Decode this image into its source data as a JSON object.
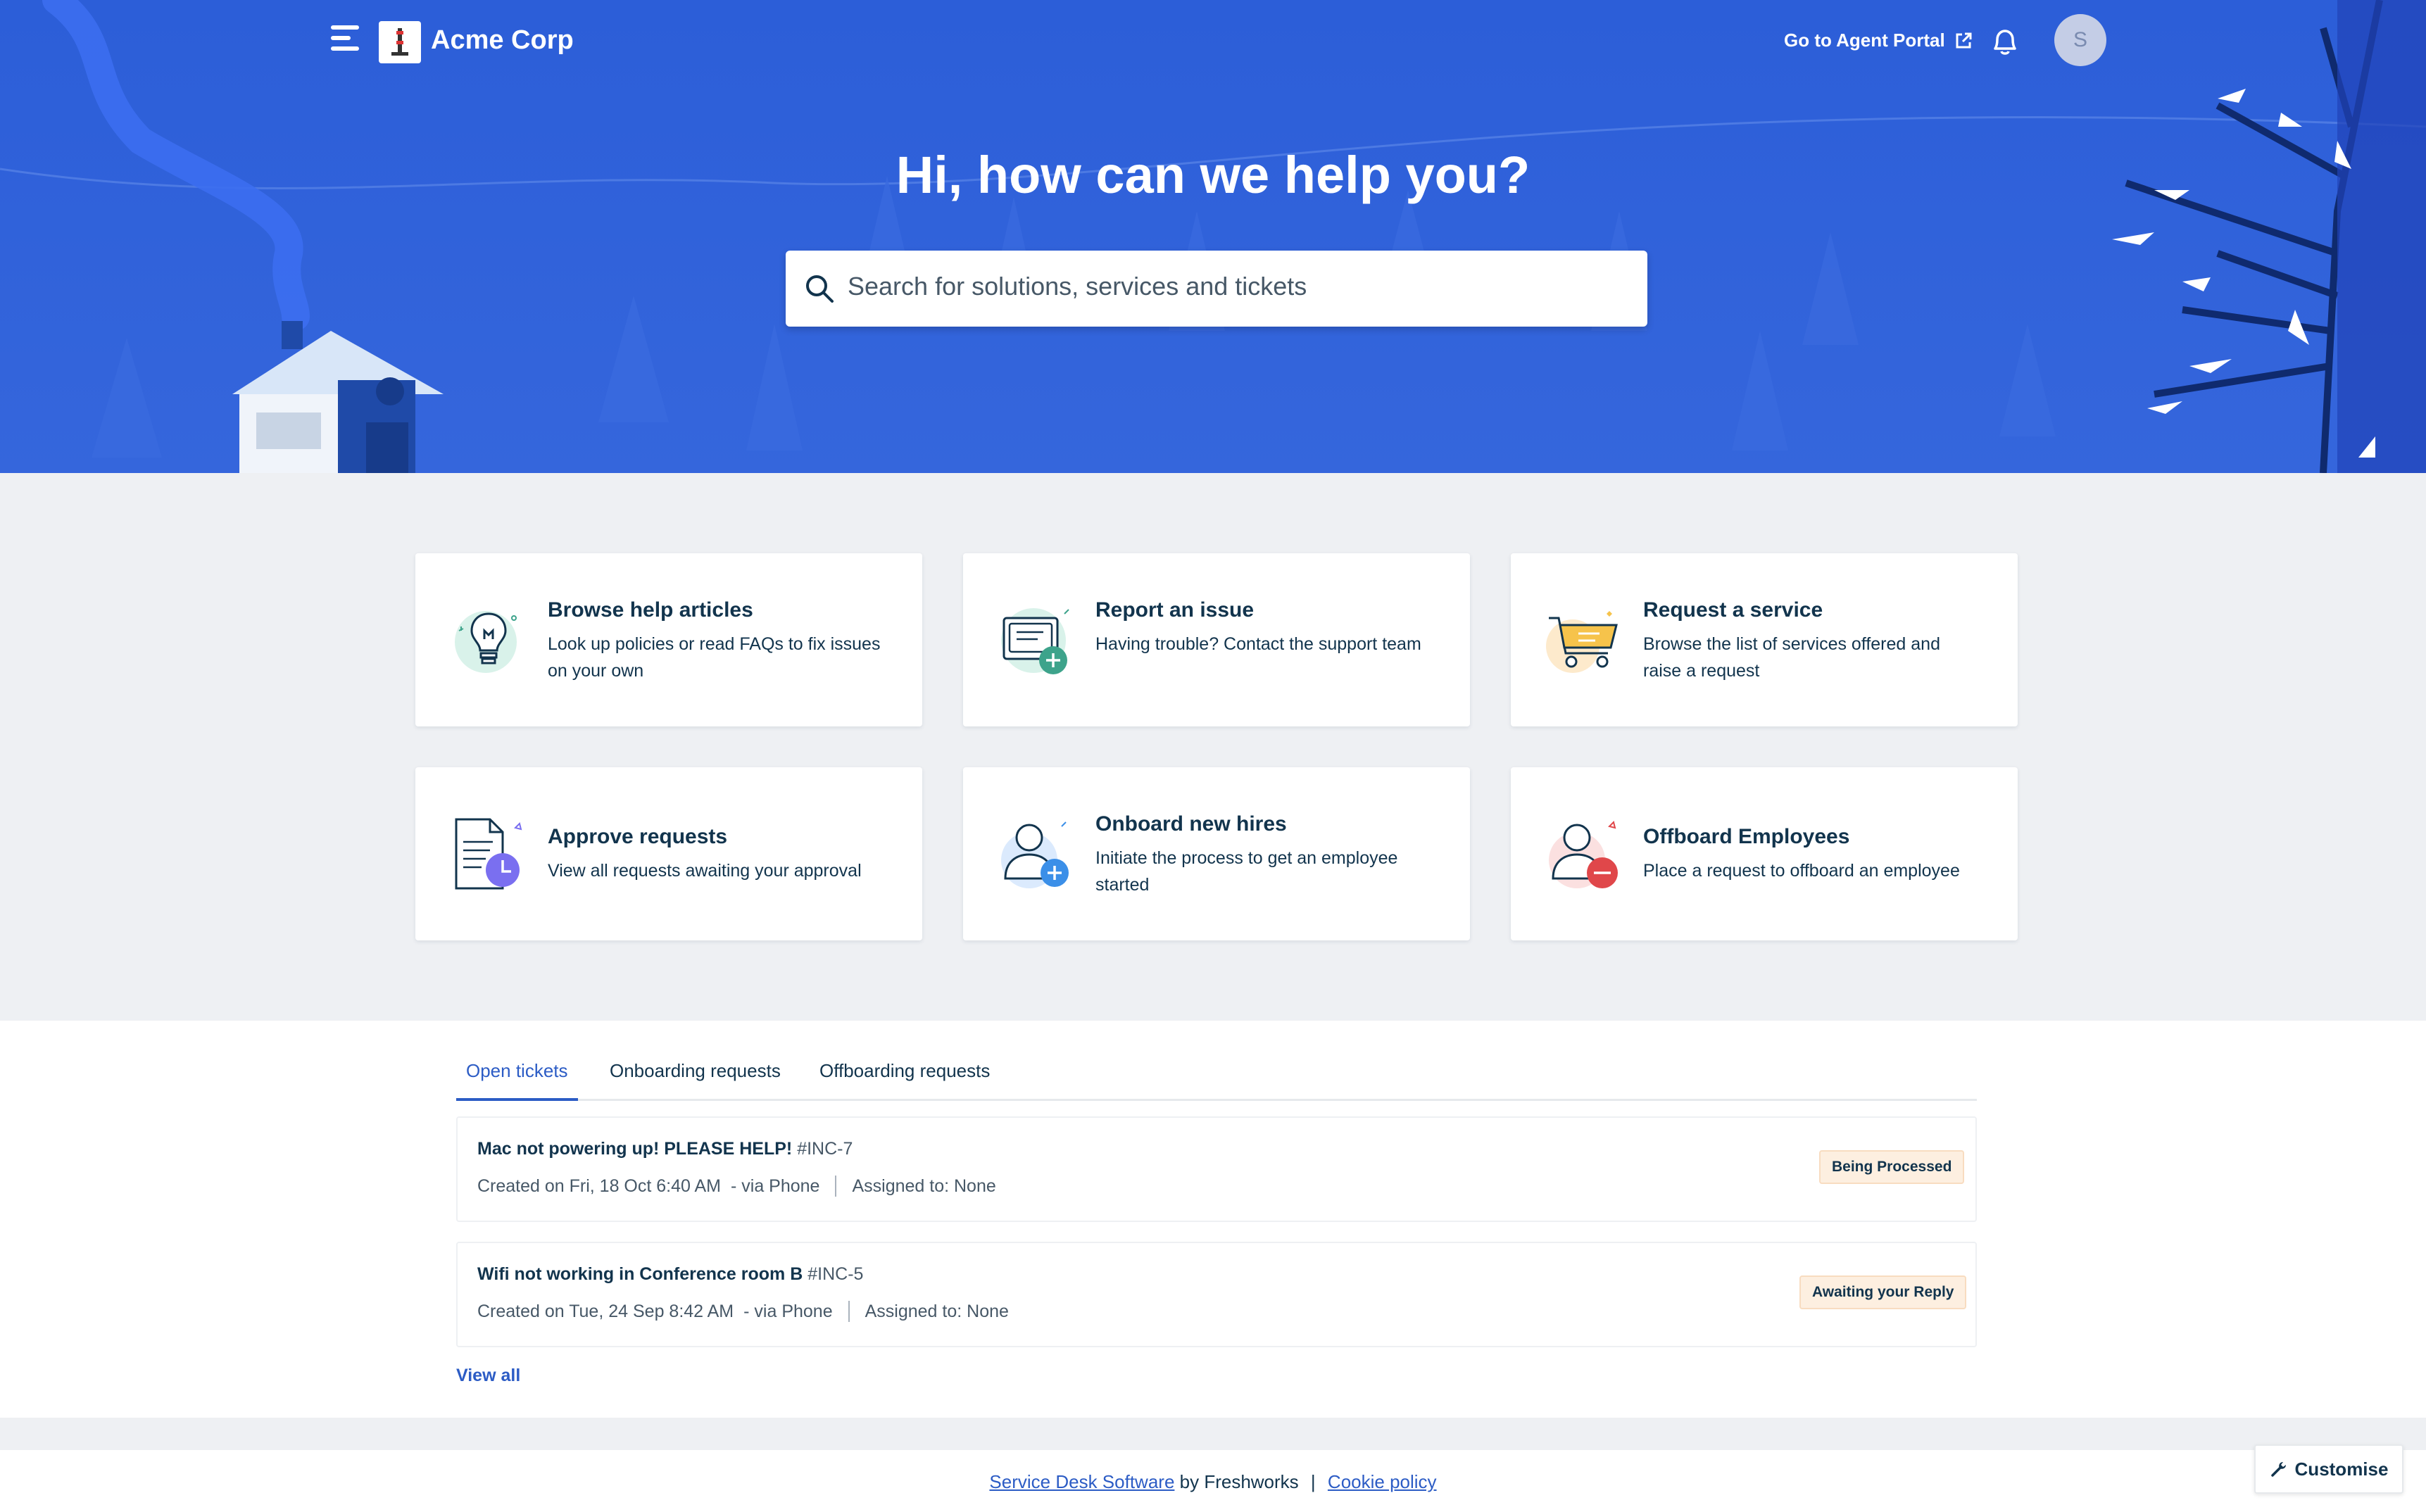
{
  "header": {
    "brand": "Acme Corp",
    "agent_portal_label": "Go to Agent Portal",
    "avatar_initial": "S"
  },
  "hero": {
    "title": "Hi, how can we help you?",
    "search_placeholder": "Search for solutions, services and tickets"
  },
  "cards": [
    {
      "title": "Browse help articles",
      "description": "Look up policies or read FAQs to fix issues on your own",
      "icon": "lightbulb-icon"
    },
    {
      "title": "Report an issue",
      "description": "Having trouble? Contact the support team",
      "icon": "report-issue-icon"
    },
    {
      "title": "Request a service",
      "description": "Browse the list of services offered and raise a request",
      "icon": "shopping-cart-icon"
    },
    {
      "title": "Approve requests",
      "description": "View all requests awaiting your approval",
      "icon": "approval-document-icon"
    },
    {
      "title": "Onboard new hires",
      "description": "Initiate the process to get an employee started",
      "icon": "add-user-icon"
    },
    {
      "title": "Offboard Employees",
      "description": "Place a request to offboard an employee",
      "icon": "remove-user-icon"
    }
  ],
  "tabs": [
    "Open tickets",
    "Onboarding requests",
    "Offboarding requests"
  ],
  "tickets": [
    {
      "title": "Mac not powering up! PLEASE HELP!",
      "id": "#INC-7",
      "created": "Created on Fri, 18 Oct 6:40 AM",
      "via": "- via Phone",
      "assigned": "Assigned to: None",
      "status": "Being Processed"
    },
    {
      "title": "Wifi not working in Conference room B",
      "id": "#INC-5",
      "created": "Created on Tue, 24 Sep 8:42 AM",
      "via": "- via Phone",
      "assigned": "Assigned to: None",
      "status": "Awaiting your Reply"
    }
  ],
  "view_all_label": "View all",
  "footer": {
    "software_link": "Service Desk Software",
    "by_text": "by Freshworks",
    "separator": "|",
    "cookie_link": "Cookie policy"
  },
  "customise_label": "Customise",
  "colors": {
    "hero_blue": "#2f61d9",
    "accent": "#2c5cc5",
    "badge_bg": "#fdefe0"
  }
}
